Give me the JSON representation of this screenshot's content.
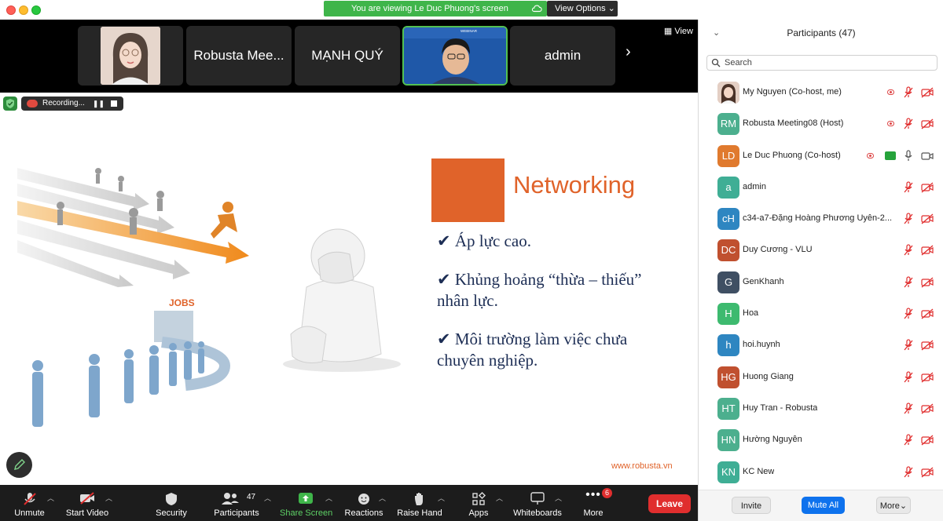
{
  "window": {
    "share_banner": "You are viewing Le Duc Phuong's screen",
    "view_options": "View Options ⌄"
  },
  "strip": {
    "tiles": [
      "Robusta Mee...",
      "MẠNH QUÝ",
      "admin"
    ],
    "view_label": "View",
    "active_speaker_caption": "WEBINAR"
  },
  "recording": {
    "label": "Recording..."
  },
  "slide": {
    "title": "Networking",
    "bullets": [
      "✔  Áp lực cao.",
      "✔ Khủng hoảng “thừa – thiếu” nhân lực.",
      "✔ Môi trường làm việc chưa chuyên nghiệp."
    ],
    "jobs_label": "JOBS",
    "url": "www.robusta.vn"
  },
  "toolbar": {
    "unmute": "Unmute",
    "start_video": "Start Video",
    "security": "Security",
    "participants": "Participants",
    "participants_count": "47",
    "share_screen": "Share Screen",
    "reactions": "Reactions",
    "raise_hand": "Raise Hand",
    "apps": "Apps",
    "whiteboards": "Whiteboards",
    "more": "More",
    "more_badge": "6",
    "leave": "Leave"
  },
  "panel": {
    "title": "Participants (47)",
    "search_placeholder": "Search",
    "participants": [
      {
        "initials": "",
        "name": "My Nguyen (Co-host, me)",
        "color": "#d9b7a8",
        "rec": true,
        "share": false,
        "mic_on": false,
        "cam_on": false
      },
      {
        "initials": "RM",
        "name": "Robusta Meeting08 (Host)",
        "color": "#4caf8e",
        "rec": true,
        "share": false,
        "mic_on": false,
        "cam_on": false
      },
      {
        "initials": "LD",
        "name": "Le Duc Phuong (Co-host)",
        "color": "#e07a2e",
        "rec": true,
        "share": true,
        "mic_on": true,
        "cam_on": true
      },
      {
        "initials": "a",
        "name": "admin",
        "color": "#3fae95",
        "rec": false,
        "share": false,
        "mic_on": false,
        "cam_on": false
      },
      {
        "initials": "cH",
        "name": "c34-a7-Đặng Hoàng Phương Uyên-2...",
        "color": "#2e86c1",
        "rec": false,
        "share": false,
        "mic_on": false,
        "cam_on": false
      },
      {
        "initials": "DC",
        "name": "Duy Cương - VLU",
        "color": "#c0502f",
        "rec": false,
        "share": false,
        "mic_on": false,
        "cam_on": false
      },
      {
        "initials": "G",
        "name": "GenKhanh",
        "color": "#3f4f63",
        "rec": false,
        "share": false,
        "mic_on": false,
        "cam_on": false
      },
      {
        "initials": "H",
        "name": "Hoa",
        "color": "#3dba6f",
        "rec": false,
        "share": false,
        "mic_on": false,
        "cam_on": false
      },
      {
        "initials": "h",
        "name": "hoi.huynh",
        "color": "#2e86c1",
        "rec": false,
        "share": false,
        "mic_on": false,
        "cam_on": false
      },
      {
        "initials": "HG",
        "name": "Huong Giang",
        "color": "#c0502f",
        "rec": false,
        "share": false,
        "mic_on": false,
        "cam_on": false
      },
      {
        "initials": "HT",
        "name": "Huy Tran - Robusta",
        "color": "#4caf8e",
        "rec": false,
        "share": false,
        "mic_on": false,
        "cam_on": false
      },
      {
        "initials": "HN",
        "name": "Hường Nguyễn",
        "color": "#4caf8e",
        "rec": false,
        "share": false,
        "mic_on": false,
        "cam_on": false
      },
      {
        "initials": "KN",
        "name": "KC New",
        "color": "#3fae95",
        "rec": false,
        "share": false,
        "mic_on": false,
        "cam_on": false
      }
    ],
    "invite": "Invite",
    "mute_all": "Mute All",
    "more": "More⌄"
  }
}
